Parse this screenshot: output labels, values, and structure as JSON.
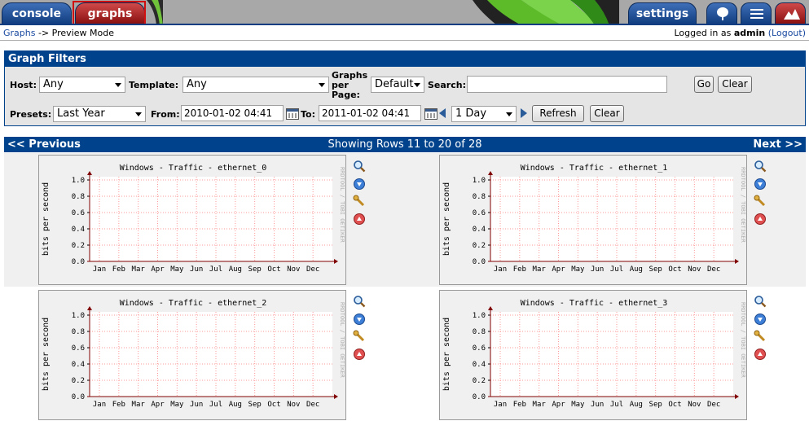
{
  "tabs": {
    "console": "console",
    "graphs": "graphs",
    "settings": "settings",
    "tree_icon": "tree-view-icon",
    "list_icon": "list-view-icon",
    "preview_icon": "preview-mode-icon"
  },
  "breadcrumb": {
    "root": "Graphs",
    "separator": " -> ",
    "current": "Preview Mode"
  },
  "login": {
    "prefix": "Logged in as ",
    "user": "admin",
    "logout": "(Logout)"
  },
  "filters": {
    "title": "Graph Filters",
    "host_label": "Host:",
    "host_value": "Any",
    "template_label": "Template:",
    "template_value": "Any",
    "per_page_label_1": "Graphs",
    "per_page_label_2": "per",
    "per_page_label_3": "Page:",
    "per_page_value": "Default",
    "search_label": "Search:",
    "search_value": "",
    "go_label": "Go",
    "clear_label": "Clear",
    "presets_label": "Presets:",
    "presets_value": "Last Year",
    "from_label": "From:",
    "from_value": "2010-01-02 04:41",
    "to_label": "To:",
    "to_value": "2011-01-02 04:41",
    "timespan_value": "1 Day",
    "refresh_label": "Refresh",
    "clear2_label": "Clear"
  },
  "nav": {
    "previous": "<< Previous",
    "showing": "Showing Rows 11 to 20 of 28",
    "next": "Next >>"
  },
  "graphs": [
    {
      "title": "Windows - Traffic - ethernet_0"
    },
    {
      "title": "Windows - Traffic - ethernet_1"
    },
    {
      "title": "Windows - Traffic - ethernet_2"
    },
    {
      "title": "Windows - Traffic - ethernet_3"
    }
  ],
  "graph_common": {
    "ylabel": "bits per second",
    "watermark": "RRDTOOL / TOBI OETIKER",
    "yticks": [
      "1.0",
      "0.8",
      "0.6",
      "0.4",
      "0.2",
      "0.0"
    ],
    "months": [
      "Jan",
      "Feb",
      "Mar",
      "Apr",
      "May",
      "Jun",
      "Jul",
      "Aug",
      "Sep",
      "Oct",
      "Nov",
      "Dec"
    ],
    "grid_color": "#ff9999",
    "axis_color": "#800000"
  },
  "graph_actions": [
    "zoom-icon",
    "export-icon",
    "edit-properties-icon",
    "move-up-icon"
  ],
  "colors": {
    "header_blue": "#00438c",
    "tab_red": "#c02828",
    "panel_grey": "#e5e5e5"
  }
}
